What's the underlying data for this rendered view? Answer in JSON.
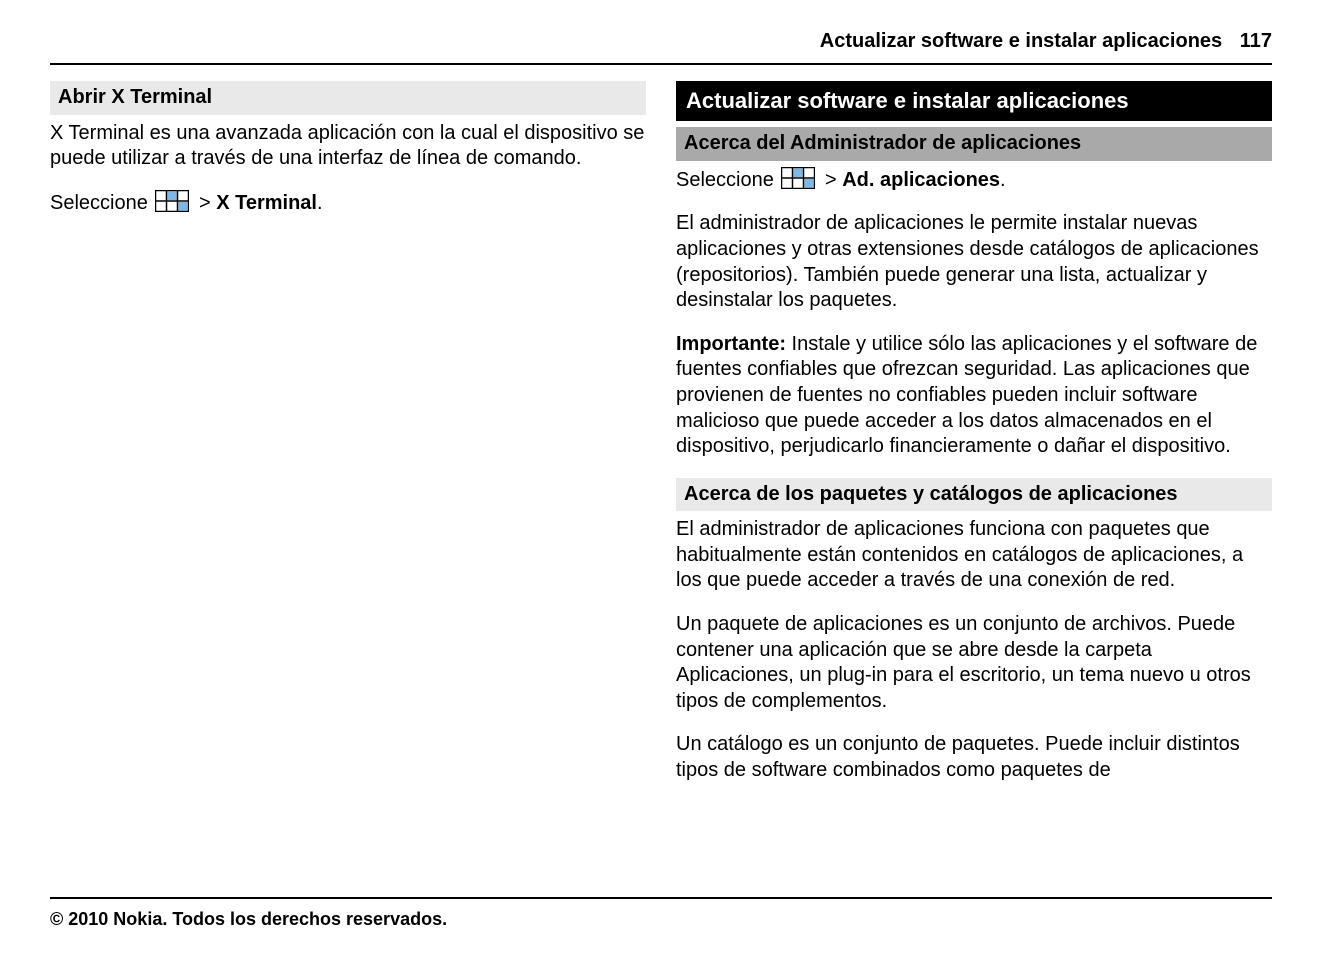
{
  "header": {
    "title": "Actualizar software e instalar aplicaciones",
    "page_number": "117"
  },
  "left": {
    "heading1": "Abrir X Terminal",
    "para1": "X Terminal es una avanzada aplicación con la cual el dispositivo se puede utilizar a través de una interfaz de línea de comando.",
    "select_prefix": "Seleccione ",
    "select_gt": " > ",
    "select_target": "X Terminal",
    "select_period": "."
  },
  "right": {
    "heading_black": "Actualizar software e instalar aplicaciones",
    "heading_gray": "Acerca del Administrador de aplicaciones",
    "select_prefix": "Seleccione ",
    "select_gt": " > ",
    "select_target": "Ad. aplicaciones",
    "select_period": ".",
    "para1": "El administrador de aplicaciones le permite instalar nuevas aplicaciones y otras extensiones desde catálogos de aplicaciones (repositorios). También puede generar una lista, actualizar y desinstalar los paquetes.",
    "important_label": "Importante:",
    "important_body": "  Instale y utilice sólo las aplicaciones y el software de fuentes confiables que ofrezcan seguridad. Las aplicaciones que provienen de fuentes no confiables pueden incluir software malicioso que puede acceder a los datos almacenados en el dispositivo, perjudicarlo financieramente o dañar el dispositivo.",
    "heading_light": "Acerca de los paquetes y catálogos de aplicaciones",
    "para2": "El administrador de aplicaciones funciona con paquetes que habitualmente están contenidos en catálogos de aplicaciones, a los que puede acceder a través de una conexión de red.",
    "para3": "Un paquete de aplicaciones es un conjunto de archivos. Puede contener una aplicación que se abre desde la carpeta Aplicaciones, un plug-in para el escritorio, un tema nuevo u otros tipos de complementos.",
    "para4": "Un catálogo es un conjunto de paquetes. Puede incluir distintos tipos de software combinados como paquetes de"
  },
  "footer": {
    "copyright": "© 2010 Nokia. Todos los derechos reservados."
  }
}
